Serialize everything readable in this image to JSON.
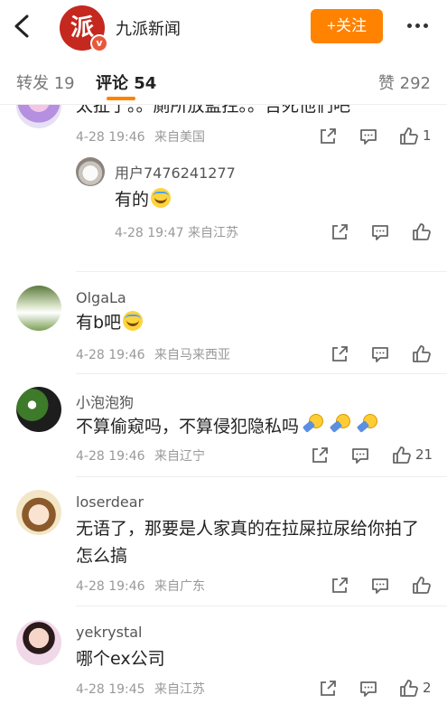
{
  "header": {
    "title": "九派新闻",
    "logo_text": "派",
    "badge": "v",
    "follow_label": "+关注"
  },
  "tabs": {
    "repost": "转发 19",
    "comments": "评论 54",
    "likes": "赞 292"
  },
  "comments": [
    {
      "username": "",
      "text": "太扯了。。廁所放監控。。告死他們吧",
      "time": "4-28 19:46",
      "location": "来自美国",
      "likes": "1",
      "reply": {
        "username": "用户7476241277",
        "text": "有的",
        "time": "4-28 19:47",
        "location": "来自江苏"
      }
    },
    {
      "username": "OlgaLa",
      "text": "有b吧",
      "time": "4-28 19:46",
      "location": "来自马来西亚",
      "likes": ""
    },
    {
      "username": "小泡泡狗",
      "text": "不算偷窥吗，不算侵犯隐私吗",
      "time": "4-28 19:46",
      "location": "来自辽宁",
      "likes": "21"
    },
    {
      "username": "loserdear",
      "text": "无语了，那要是人家真的在拉屎拉尿给你拍了怎么搞",
      "time": "4-28 19:46",
      "location": "来自广东",
      "likes": ""
    },
    {
      "username": "yekrystal",
      "text": "哪个ex公司",
      "time": "4-28 19:45",
      "location": "来自江苏",
      "likes": "2"
    }
  ],
  "colors": {
    "accent": "#ff8200",
    "logo": "#c5281e",
    "text_primary": "#222222",
    "text_meta": "#999999"
  },
  "icons": [
    "back-arrow-icon",
    "more-icon",
    "share-icon",
    "comment-icon",
    "like-icon",
    "laugh-tears-emoji",
    "wrench-emoji"
  ]
}
